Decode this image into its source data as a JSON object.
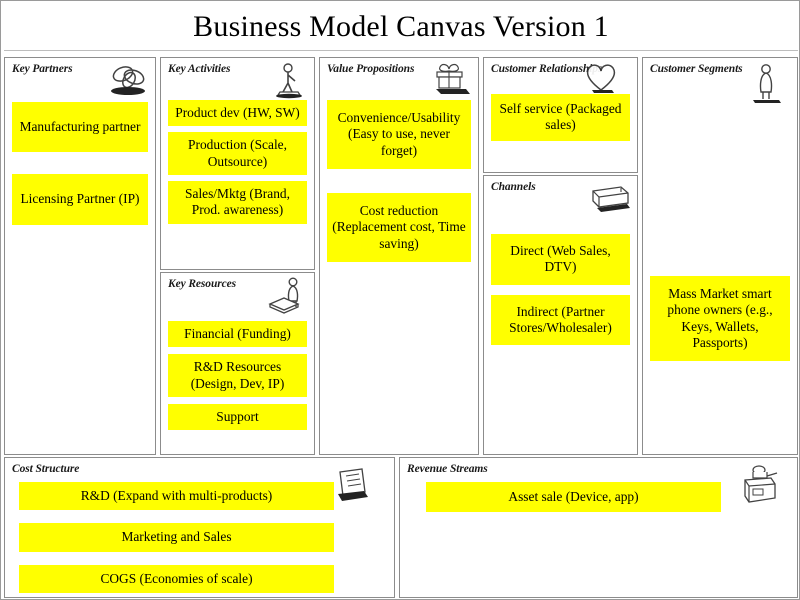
{
  "title": "Business Model Canvas Version 1",
  "colors": {
    "note_fill": "#FFFF00",
    "note_text": "#000000",
    "block_border": "#8C8C8C",
    "page_background": "#FFFFFF"
  },
  "blocks": {
    "key_partners": {
      "header": "Key Partners",
      "icon": "linked-rings-icon",
      "notes": [
        "Manufacturing partner",
        "Licensing Partner (IP)"
      ]
    },
    "key_activities": {
      "header": "Key Activities",
      "icon": "worker-person-icon",
      "notes": [
        "Product dev (HW, SW)",
        "Production (Scale, Outsource)",
        "Sales/Mktg (Brand, Prod. awareness)"
      ]
    },
    "key_resources": {
      "header": "Key Resources",
      "icon": "person-with-resources-icon",
      "notes": [
        "Financial (Funding)",
        "R&D Resources (Design, Dev, IP)",
        "Support"
      ]
    },
    "value_propositions": {
      "header": "Value Propositions",
      "icon": "gift-box-icon",
      "notes": [
        "Convenience/Usability (Easy to use, never forget)",
        "Cost reduction (Replacement cost, Time saving)"
      ]
    },
    "customer_relationships": {
      "header": "Customer Relationships",
      "icon": "heart-icon",
      "notes": [
        "Self service (Packaged sales)"
      ]
    },
    "channels": {
      "header": "Channels",
      "icon": "delivery-truck-icon",
      "notes": [
        "Direct (Web Sales, DTV)",
        "Indirect (Partner Stores/Wholesaler)"
      ]
    },
    "customer_segments": {
      "header": "Customer Segments",
      "icon": "standing-person-icon",
      "notes": [
        "Mass Market smart phone owners (e.g., Keys, Wallets, Passports)"
      ]
    },
    "cost_structure": {
      "header": "Cost Structure",
      "icon": "receipt-notepad-icon",
      "notes": [
        "R&D (Expand with multi-products)",
        "Marketing and Sales",
        "COGS (Economies of scale)"
      ]
    },
    "revenue_streams": {
      "header": "Revenue Streams",
      "icon": "cash-register-icon",
      "notes": [
        "Asset sale (Device, app)"
      ]
    }
  }
}
